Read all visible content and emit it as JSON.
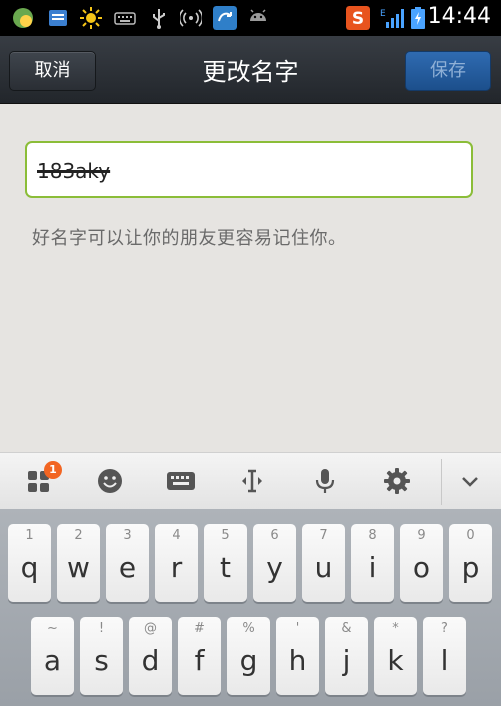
{
  "status_bar": {
    "time": "14:44",
    "icons": [
      "app-icon",
      "mail-icon",
      "brightness-icon",
      "keyboard-icon",
      "usb-icon",
      "wifi-hotspot-icon",
      "sync-icon",
      "android-icon",
      "sogou-icon",
      "signal-icon",
      "battery-icon"
    ],
    "network_label": "E"
  },
  "title_bar": {
    "cancel_label": "取消",
    "title": "更改名字",
    "save_label": "保存"
  },
  "form": {
    "name_value": "183aky",
    "hint": "好名字可以让你的朋友更容易记住你。"
  },
  "keyboard_toolbar": {
    "badge_count": "1",
    "icons": [
      "apps-icon",
      "emoji-icon",
      "keyboard-icon",
      "cursor-icon",
      "microphone-icon",
      "gear-icon",
      "chevron-down-icon"
    ]
  },
  "keyboard": {
    "row1": [
      {
        "num": "1",
        "ch": "q"
      },
      {
        "num": "2",
        "ch": "w"
      },
      {
        "num": "3",
        "ch": "e"
      },
      {
        "num": "4",
        "ch": "r"
      },
      {
        "num": "5",
        "ch": "t"
      },
      {
        "num": "6",
        "ch": "y"
      },
      {
        "num": "7",
        "ch": "u"
      },
      {
        "num": "8",
        "ch": "i"
      },
      {
        "num": "9",
        "ch": "o"
      },
      {
        "num": "0",
        "ch": "p"
      }
    ],
    "row2": [
      {
        "num": "~",
        "ch": "a"
      },
      {
        "num": "!",
        "ch": "s"
      },
      {
        "num": "@",
        "ch": "d"
      },
      {
        "num": "#",
        "ch": "f"
      },
      {
        "num": "%",
        "ch": "g"
      },
      {
        "num": "'",
        "ch": "h"
      },
      {
        "num": "&",
        "ch": "j"
      },
      {
        "num": "*",
        "ch": "k"
      },
      {
        "num": "?",
        "ch": "l"
      }
    ]
  },
  "colors": {
    "accent_green": "#8bbd38",
    "save_blue": "#2f6bb2",
    "badge_orange": "#f26522"
  }
}
